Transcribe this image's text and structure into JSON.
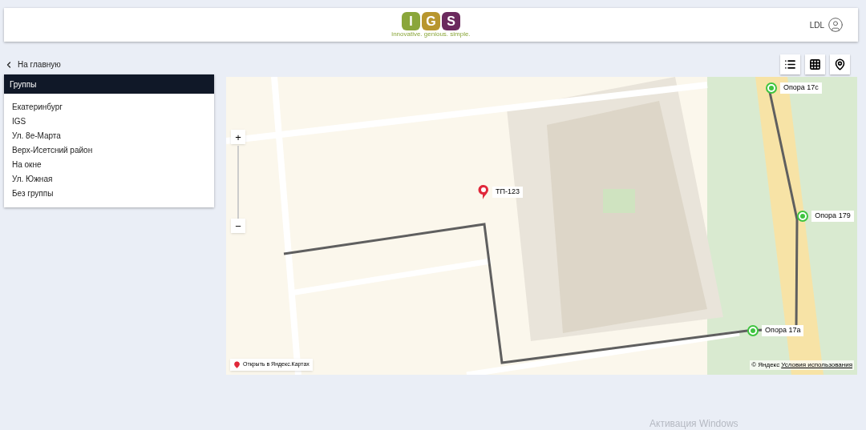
{
  "header": {
    "logo": {
      "letters": [
        {
          "text": "I",
          "color": "#8aa63a"
        },
        {
          "text": "G",
          "color": "#b8962e"
        },
        {
          "text": "S",
          "color": "#6b2a5e"
        }
      ],
      "tagline": "innovative. genious. simple."
    },
    "user": "LDL"
  },
  "back_link": "На главную",
  "view_buttons": [
    {
      "kind": "list"
    },
    {
      "kind": "grid"
    },
    {
      "kind": "map"
    }
  ],
  "groups": {
    "title": "Группы",
    "items": [
      "Екатеринбург",
      "IGS",
      "Ул. 8е-Марта",
      "Верх-Исетсний район",
      "На окне",
      "Ул. Южная",
      "Без группы"
    ]
  },
  "map": {
    "markers": [
      {
        "label": "ТП-123",
        "kind": "pin"
      },
      {
        "label": "Опора 17с",
        "kind": "pole"
      },
      {
        "label": "Опора 179",
        "kind": "pole"
      },
      {
        "label": "Опора 17а",
        "kind": "pole"
      }
    ],
    "zoom_in": "+",
    "zoom_out": "−",
    "open_link": "Открыть в Яндекс.Картах",
    "copyright": "© Яндекс",
    "terms_link": "Условия использования"
  },
  "os_overlay": "Активация Windows"
}
